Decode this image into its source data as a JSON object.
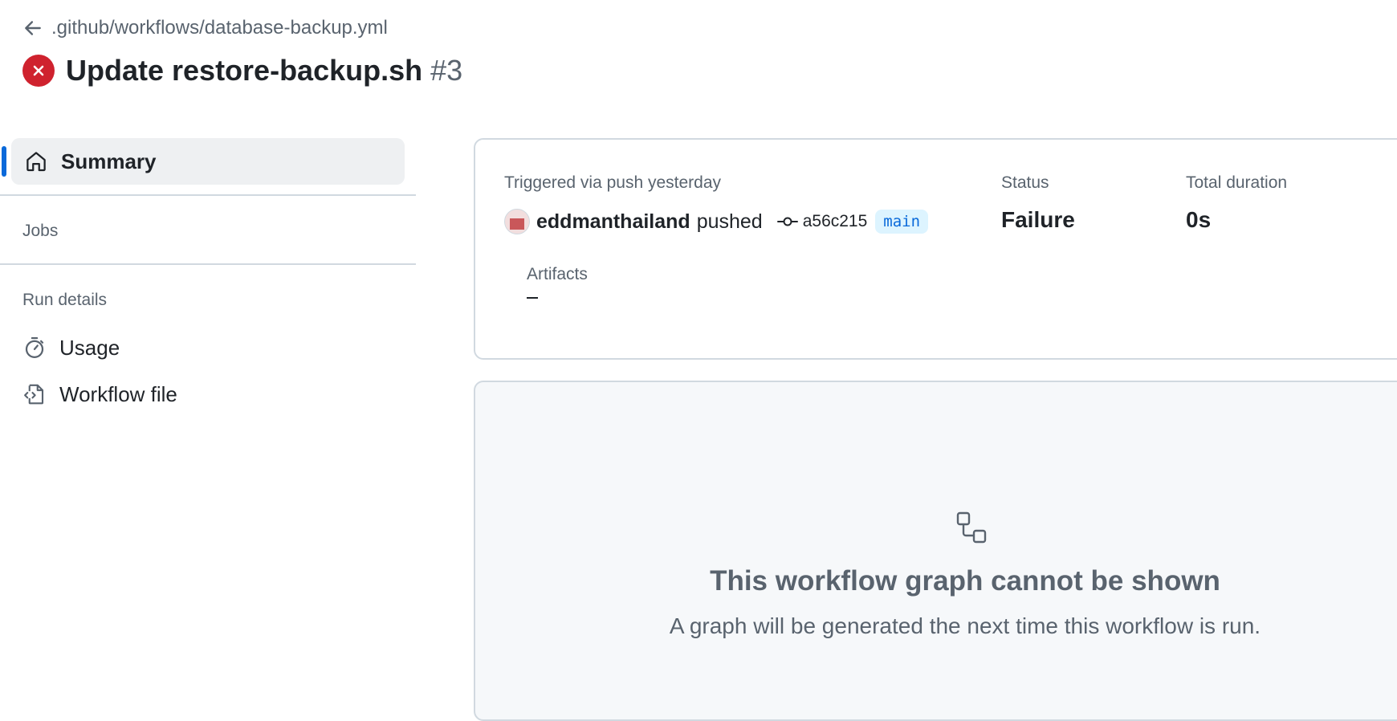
{
  "header": {
    "breadcrumb": ".github/workflows/database-backup.yml",
    "title": "Update restore-backup.sh",
    "run_number": "#3",
    "status_icon": "x-circle-fill-icon",
    "status_color": "#cf222e"
  },
  "sidebar": {
    "summary_label": "Summary",
    "jobs_label": "Jobs",
    "run_details_label": "Run details",
    "usage_label": "Usage",
    "workflow_file_label": "Workflow file",
    "accent_color": "#0969da"
  },
  "summary": {
    "triggered_text": "Triggered via push yesterday",
    "actor": "eddmanthailand",
    "action": "pushed",
    "commit_sha": "a56c215",
    "branch": "main",
    "status_label": "Status",
    "status_value": "Failure",
    "duration_label": "Total duration",
    "duration_value": "0s",
    "artifacts_label": "Artifacts"
  },
  "graph": {
    "title": "This workflow graph cannot be shown",
    "subtitle": "A graph will be generated the next time this workflow is run."
  }
}
